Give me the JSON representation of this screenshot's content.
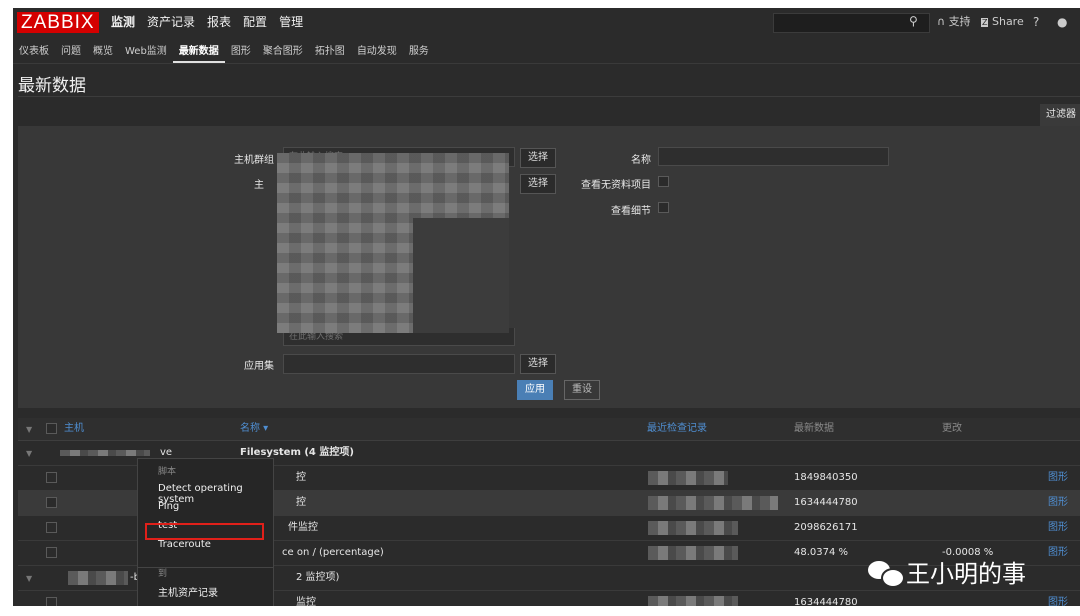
{
  "header": {
    "logo": "ZABBIX",
    "menu": [
      "监测",
      "资产记录",
      "报表",
      "配置",
      "管理"
    ],
    "active_menu": "监测",
    "support": "支持",
    "share": "Share",
    "help": "?"
  },
  "submenu": [
    "仪表板",
    "问题",
    "概览",
    "Web监测",
    "最新数据",
    "图形",
    "聚合图形",
    "拓扑图",
    "自动发现",
    "服务"
  ],
  "page_title": "最新数据",
  "filter": {
    "tab_label": "过滤器",
    "host_group_label": "主机群组",
    "host_group_placeholder": "在此输入搜索",
    "host_placeholder": "在此输入搜索",
    "select_label": "选择",
    "application_label": "应用集",
    "name_label": "名称",
    "show_without_data_label": "查看无资料项目",
    "show_details_label": "查看细节",
    "apply_label": "应用",
    "reset_label": "重设"
  },
  "table": {
    "headers": {
      "host": "主机",
      "name": "名称 ▾",
      "last_check": "最近检查记录",
      "last_value": "最新数据",
      "change": "更改"
    },
    "group1_host": "ve",
    "group1_title": "Filesystem (4 监控项)",
    "rows": [
      {
        "name": "控",
        "last_value": "1849840350",
        "change": "",
        "action": "图形"
      },
      {
        "name": "控",
        "last_value": "1634444780",
        "change": "",
        "action": "图形"
      },
      {
        "name": "件监控",
        "last_value": "2098626171",
        "change": "",
        "action": "图形"
      },
      {
        "name": "ce on / (percentage)",
        "last_value": "48.0374 %",
        "change": "-0.0008 %",
        "action": "图形"
      }
    ],
    "group2_host": "-b",
    "group2_title": "2 监控项)",
    "row_last": {
      "name": "监控",
      "last_value": "1634444780",
      "action": "图形"
    }
  },
  "context_menu": {
    "scripts_header": "脚本",
    "items": [
      "Detect operating system",
      "Ping",
      "test",
      "Traceroute"
    ],
    "goto_header": "到",
    "goto_items": [
      "主机资产记录"
    ]
  },
  "watermark": "王小明的事"
}
